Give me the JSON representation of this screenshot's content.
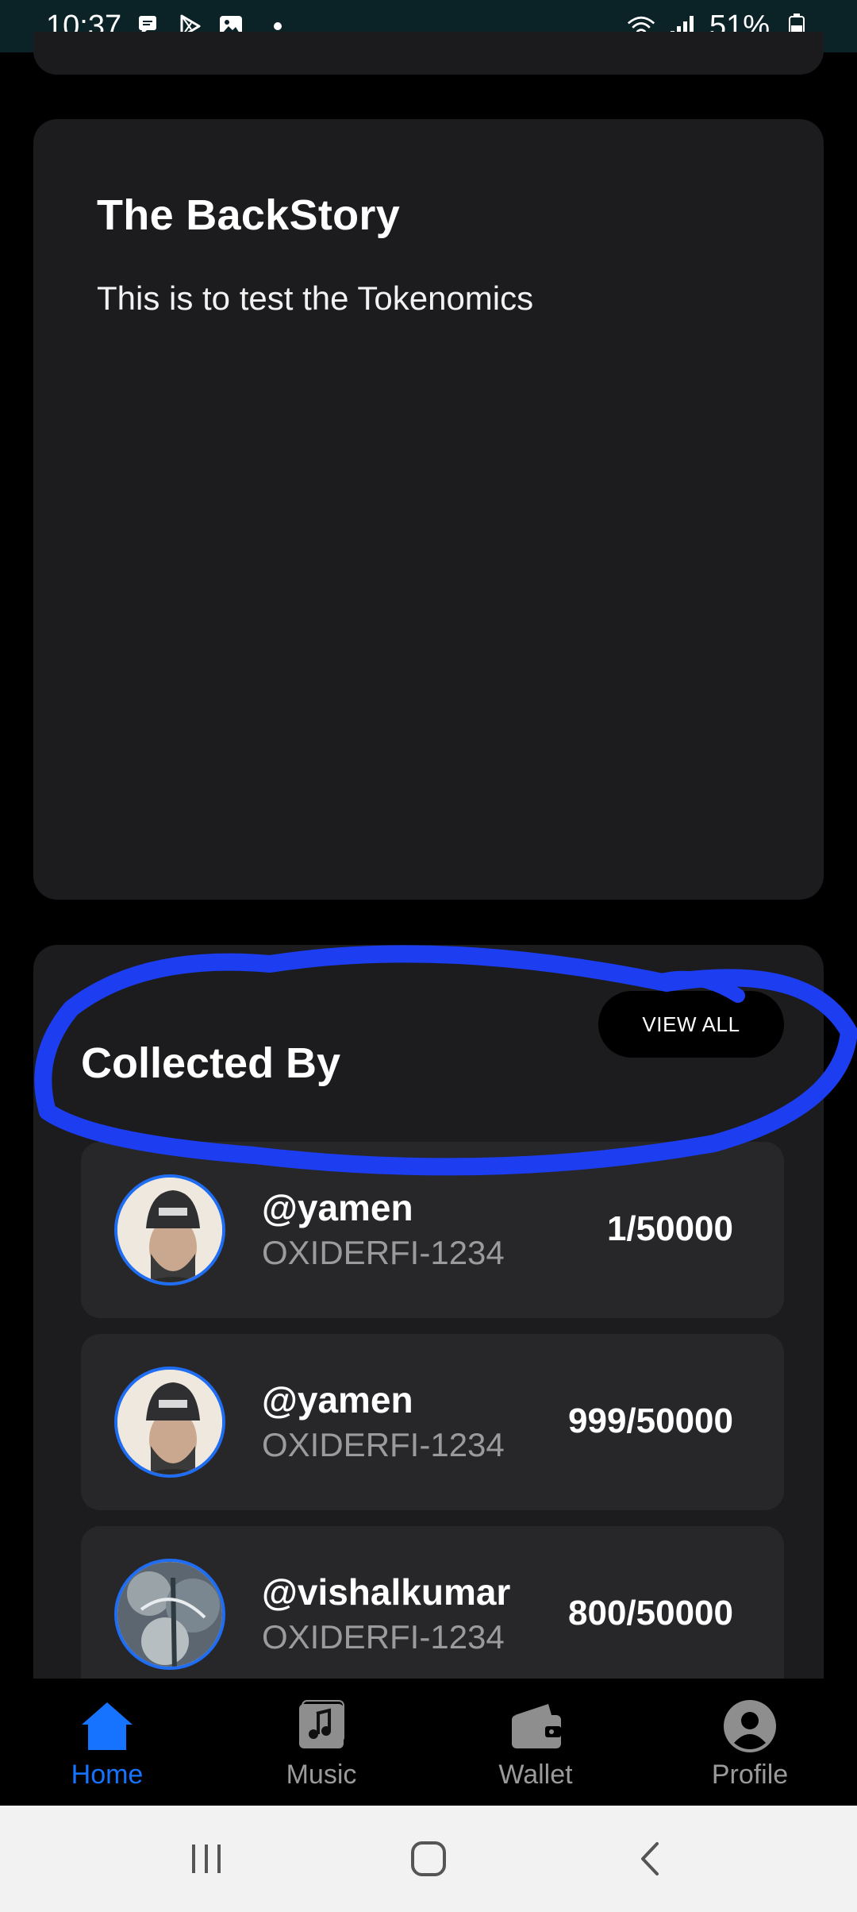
{
  "status_bar": {
    "time": "10:37",
    "battery": "51%",
    "icons_left": [
      "chat-icon",
      "play-store-icon",
      "gallery-icon",
      "notification-dot"
    ],
    "icons_right": [
      "wifi-icon",
      "signal-icon",
      "battery-icon"
    ]
  },
  "backstory": {
    "title": "The BackStory",
    "text": "This is to test the Tokenomics"
  },
  "collected": {
    "title": "Collected By",
    "view_all_label": "VIEW ALL",
    "items": [
      {
        "username": "@yamen",
        "token": "OXIDERFI-1234",
        "count": "1/50000"
      },
      {
        "username": "@yamen",
        "token": "OXIDERFI-1234",
        "count": "999/50000"
      },
      {
        "username": "@vishalkumar",
        "token": "OXIDERFI-1234",
        "count": "800/50000"
      }
    ]
  },
  "bottom_nav": {
    "items": [
      {
        "label": "Home",
        "icon": "home-icon",
        "active": true
      },
      {
        "label": "Music",
        "icon": "music-icon",
        "active": false
      },
      {
        "label": "Wallet",
        "icon": "wallet-icon",
        "active": false
      },
      {
        "label": "Profile",
        "icon": "profile-icon",
        "active": false
      }
    ]
  },
  "colors": {
    "accent": "#1673ff",
    "annotation": "#1d3df0",
    "card_bg": "#1c1c1f",
    "row_bg": "#27272a",
    "status_bar_bg": "#0b2227"
  }
}
